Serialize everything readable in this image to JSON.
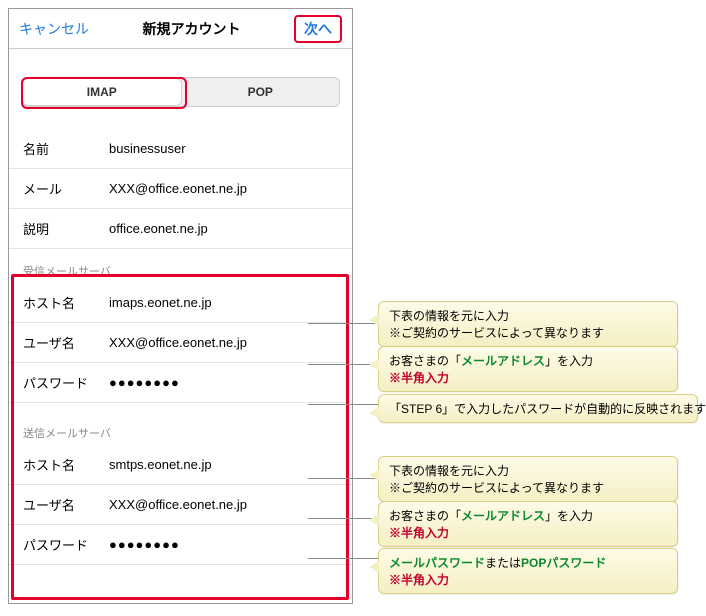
{
  "nav": {
    "cancel": "キャンセル",
    "title": "新規アカウント",
    "next": "次へ"
  },
  "tabs": {
    "imap": "IMAP",
    "pop": "POP"
  },
  "account": {
    "name_label": "名前",
    "name_value": "businessuser",
    "mail_label": "メール",
    "mail_value": "XXX@office.eonet.ne.jp",
    "desc_label": "説明",
    "desc_value": "office.eonet.ne.jp"
  },
  "incoming": {
    "header": "受信メールサーバ",
    "host_label": "ホスト名",
    "host_value": "imaps.eonet.ne.jp",
    "user_label": "ユーザ名",
    "user_value": "XXX@office.eonet.ne.jp",
    "pass_label": "パスワード",
    "pass_value": "●●●●●●●●"
  },
  "outgoing": {
    "header": "送信メールサーバ",
    "host_label": "ホスト名",
    "host_value": "smtps.eonet.ne.jp",
    "user_label": "ユーザ名",
    "user_value": "XXX@office.eonet.ne.jp",
    "pass_label": "パスワード",
    "pass_value": "●●●●●●●●"
  },
  "callouts": {
    "c1a": "下表の情報を元に入力",
    "c1b": "※ご契約のサービスによって異なります",
    "c2a_pre": "お客さまの「",
    "c2a_g": "メールアドレス",
    "c2a_post": "」を入力",
    "c2b": "※半角入力",
    "c3": "「STEP 6」で入力したパスワードが自動的に反映されます",
    "c4a": "下表の情報を元に入力",
    "c4b": "※ご契約のサービスによって異なります",
    "c5a_pre": "お客さまの「",
    "c5a_g": "メールアドレス",
    "c5a_post": "」を入力",
    "c5b": "※半角入力",
    "c6a_g1": "メールパスワード",
    "c6a_mid": "または",
    "c6a_g2": "POPパスワード",
    "c6b": "※半角入力"
  }
}
